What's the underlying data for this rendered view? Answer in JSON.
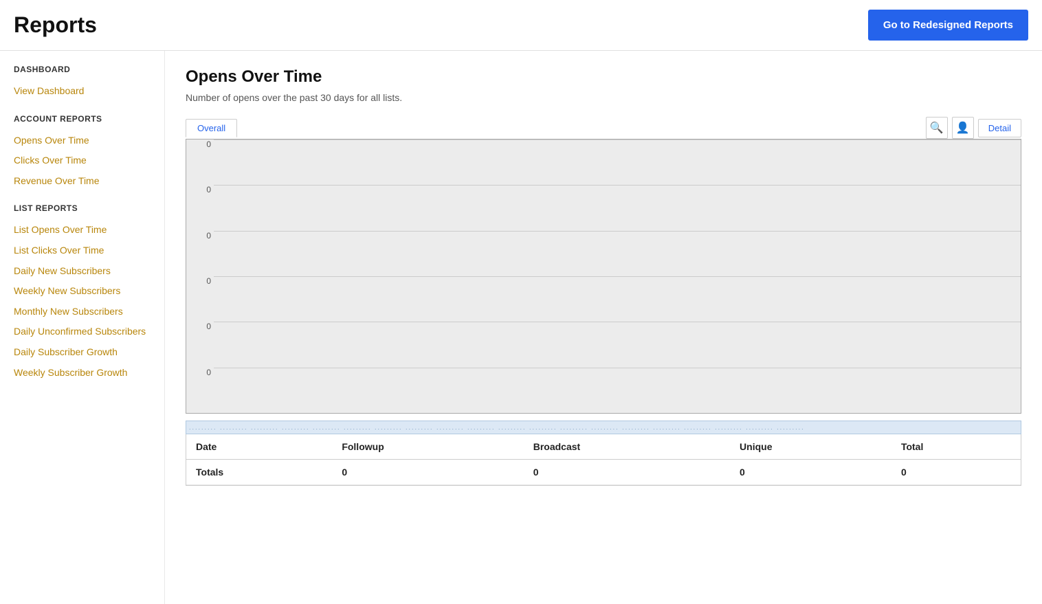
{
  "header": {
    "title": "Reports",
    "redesigned_btn_label": "Go to Redesigned Reports"
  },
  "sidebar": {
    "sections": [
      {
        "title": "DASHBOARD",
        "items": [
          {
            "label": "View Dashboard",
            "id": "view-dashboard"
          }
        ]
      },
      {
        "title": "ACCOUNT REPORTS",
        "items": [
          {
            "label": "Opens Over Time",
            "id": "opens-over-time"
          },
          {
            "label": "Clicks Over Time",
            "id": "clicks-over-time"
          },
          {
            "label": "Revenue Over Time",
            "id": "revenue-over-time"
          }
        ]
      },
      {
        "title": "LIST REPORTS",
        "items": [
          {
            "label": "List Opens Over Time",
            "id": "list-opens-over-time"
          },
          {
            "label": "List Clicks Over Time",
            "id": "list-clicks-over-time"
          },
          {
            "label": "Daily New Subscribers",
            "id": "daily-new-subscribers"
          },
          {
            "label": "Weekly New Subscribers",
            "id": "weekly-new-subscribers"
          },
          {
            "label": "Monthly New Subscribers",
            "id": "monthly-new-subscribers"
          },
          {
            "label": "Daily Unconfirmed Subscribers",
            "id": "daily-unconfirmed-subscribers"
          },
          {
            "label": "Daily Subscriber Growth",
            "id": "daily-subscriber-growth"
          },
          {
            "label": "Weekly Subscriber Growth",
            "id": "weekly-subscriber-growth"
          }
        ]
      }
    ]
  },
  "main": {
    "report_title": "Opens Over Time",
    "report_subtitle": "Number of opens over the past 30 days for all lists.",
    "chart": {
      "tab_label": "Overall",
      "detail_btn": "Detail",
      "y_labels": [
        "0",
        "0",
        "0",
        "0",
        "0",
        "0"
      ]
    },
    "table": {
      "columns": [
        "Date",
        "Followup",
        "Broadcast",
        "Unique",
        "Total"
      ],
      "rows": [
        {
          "type": "totals",
          "cells": [
            "Totals",
            "0",
            "0",
            "0",
            "0"
          ]
        }
      ]
    }
  }
}
